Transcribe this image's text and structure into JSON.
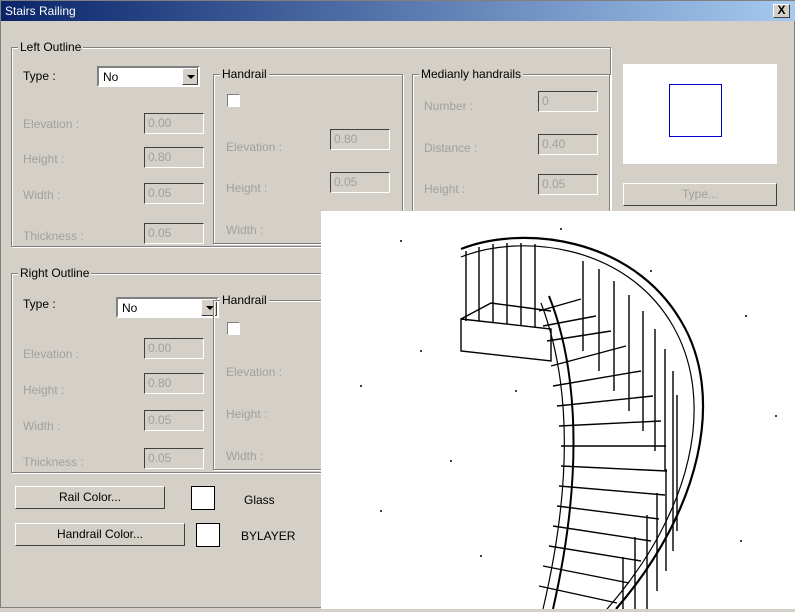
{
  "window": {
    "title": "Stairs Railing",
    "close_label": "X"
  },
  "left_outline": {
    "title": "Left Outline",
    "type_label": "Type :",
    "type_value": "No",
    "elevation_label": "Elevation :",
    "elevation_value": "0.00",
    "height_label": "Height :",
    "height_value": "0.80",
    "width_label": "Width :",
    "width_value": "0.05",
    "thickness_label": "Thickness :",
    "thickness_value": "0.05",
    "handrail": {
      "title": "Handrail",
      "elevation_label": "Elevation :",
      "elevation_value": "0.80",
      "height_label": "Height :",
      "height_value": "0.05",
      "width_label": "Width :"
    }
  },
  "medianly": {
    "title": "Medianly handrails",
    "number_label": "Number :",
    "number_value": "0",
    "distance_label": "Distance :",
    "distance_value": "0.40",
    "height_label": "Height :",
    "height_value": "0.05"
  },
  "type_button_label": "Type...",
  "right_outline": {
    "title": "Right Outline",
    "type_label": "Type :",
    "type_value": "No",
    "elevation_label": "Elevation :",
    "elevation_value": "0.00",
    "height_label": "Height :",
    "height_value": "0.80",
    "width_label": "Width :",
    "width_value": "0.05",
    "thickness_label": "Thickness :",
    "thickness_value": "0.05",
    "handrail": {
      "title": "Handrail",
      "elevation_label": "Elevation :",
      "height_label": "Height :",
      "width_label": "Width :"
    }
  },
  "rail_color": {
    "button_label": "Rail Color...",
    "value": "Glass"
  },
  "handrail_color": {
    "button_label": "Handrail Color...",
    "value": "BYLAYER"
  }
}
